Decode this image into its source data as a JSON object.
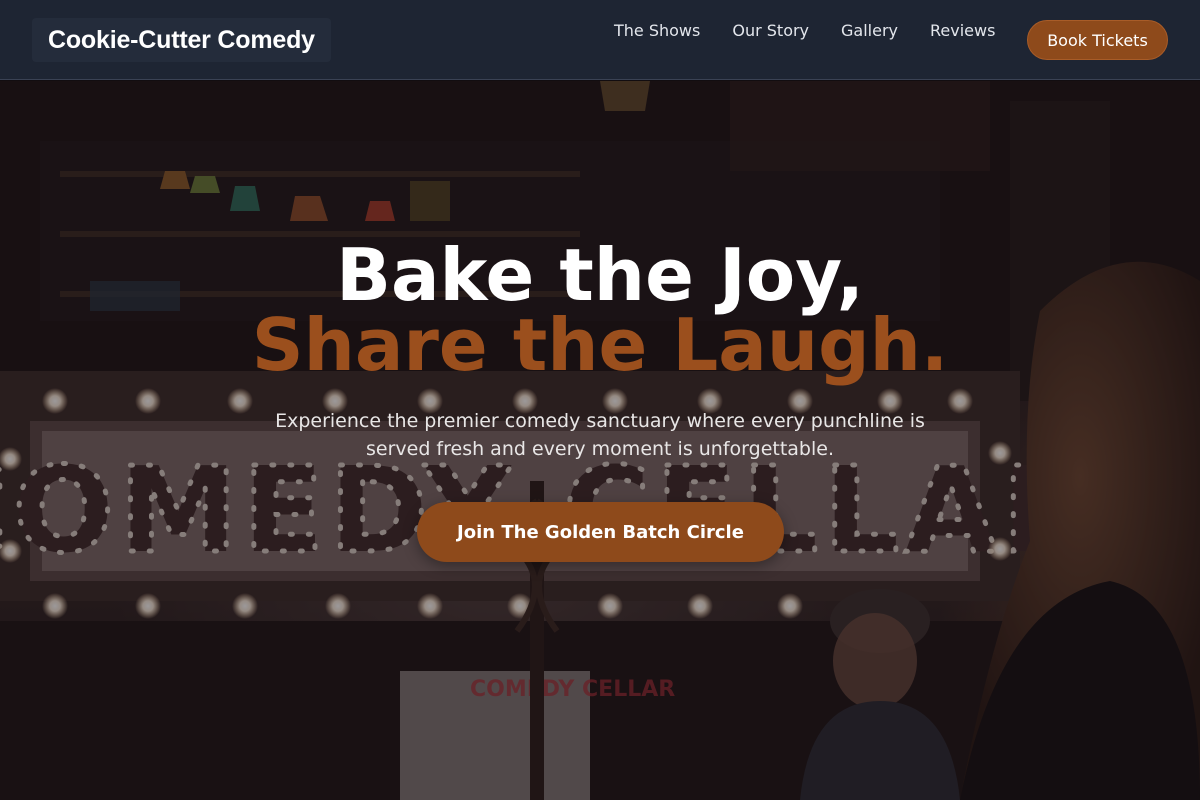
{
  "brand": {
    "name": "Cookie-Cutter Comedy"
  },
  "nav": {
    "links": [
      {
        "label": "The Shows"
      },
      {
        "label": "Our Story"
      },
      {
        "label": "Gallery"
      },
      {
        "label": "Reviews"
      }
    ],
    "cta_label": "Book Tickets"
  },
  "hero": {
    "headline_line1": "Bake the Joy,",
    "headline_line2": "Share the Laugh.",
    "subtitle": "Experience the premier comedy sanctuary where every punchline is served fresh and every moment is unforgettable.",
    "cta_label": "Join The Golden Batch Circle",
    "background_image": {
      "description": "comedy club marquee photo",
      "sign_text": "COMEDY CELLAR",
      "small_sign_text": "COMEDY CELLAR"
    }
  },
  "colors": {
    "nav_bg": "#1e2533",
    "accent": "#8e4a1b",
    "headline_accent": "#9b4f1d",
    "text_light": "#ffffff"
  }
}
